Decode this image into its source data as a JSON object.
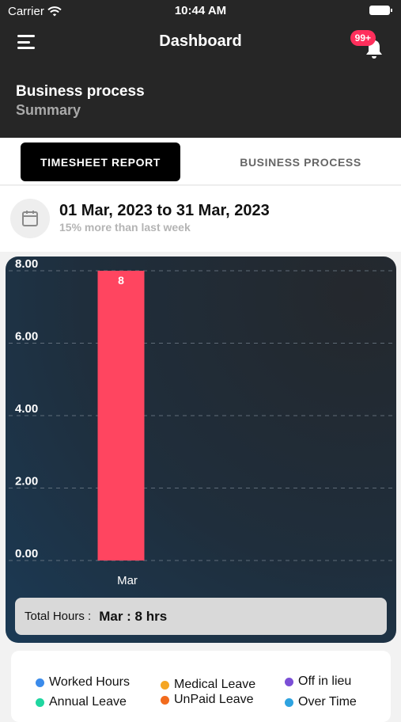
{
  "status_bar": {
    "carrier": "Carrier",
    "time": "10:44 AM"
  },
  "header": {
    "title": "Dashboard",
    "notification_badge": "99+",
    "section_title": "Business process",
    "section_subtitle": "Summary"
  },
  "tabs": [
    {
      "label": "TIMESHEET REPORT",
      "active": true
    },
    {
      "label": "BUSINESS PROCESS",
      "active": false
    }
  ],
  "date_range": {
    "text": "01 Mar, 2023 to 31 Mar, 2023",
    "subtitle": "15% more than last week"
  },
  "chart_data": {
    "type": "bar",
    "categories": [
      "Mar"
    ],
    "values": [
      8
    ],
    "data_labels": [
      "8"
    ],
    "ytick_labels": [
      "8.00",
      "6.00",
      "4.00",
      "2.00",
      "0.00"
    ],
    "yticks": [
      8,
      6,
      4,
      2,
      0
    ],
    "ylim": [
      0,
      8
    ],
    "grid": true,
    "bar_color": "#ff4560"
  },
  "total": {
    "label": "Total Hours :",
    "value": "Mar : 8 hrs"
  },
  "legend": [
    {
      "label": "Worked Hours",
      "color": "#3b8beb"
    },
    {
      "label": "Medical Leave",
      "color": "#f5a623"
    },
    {
      "label": "Off in lieu",
      "color": "#7b4fd6"
    },
    {
      "label": "Annual Leave",
      "color": "#1fd6a0"
    },
    {
      "label": "UnPaid Leave",
      "color": "#f26b1d"
    },
    {
      "label": "Over Time",
      "color": "#2ea3e0"
    }
  ]
}
